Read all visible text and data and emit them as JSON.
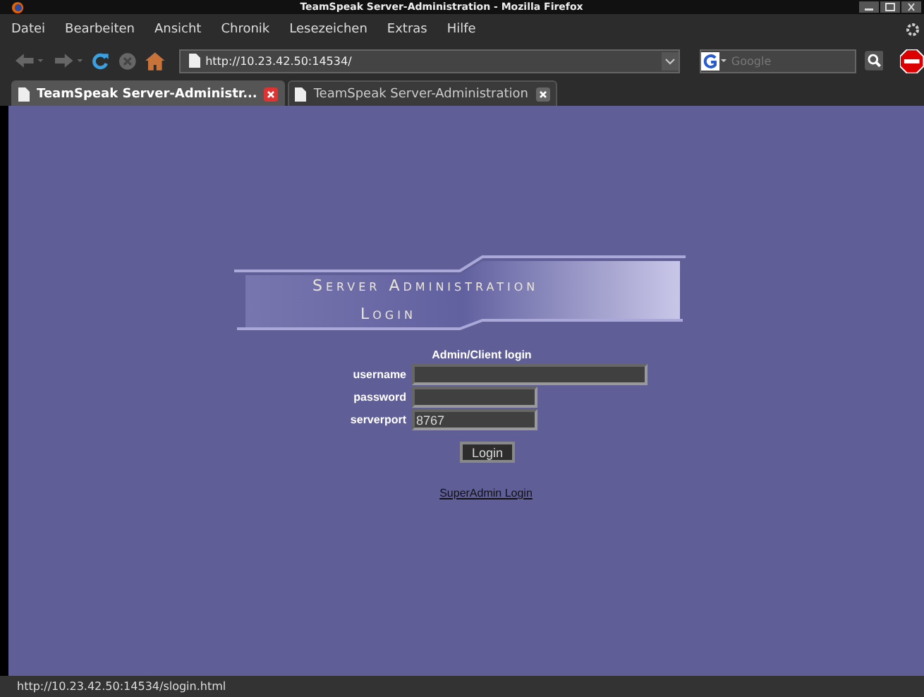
{
  "window": {
    "title": "TeamSpeak Server-Administration - Mozilla Firefox"
  },
  "menu": [
    "Datei",
    "Bearbeiten",
    "Ansicht",
    "Chronik",
    "Lesezeichen",
    "Extras",
    "Hilfe"
  ],
  "address": {
    "value": "http://10.23.42.50:14534/"
  },
  "search": {
    "placeholder": "Google"
  },
  "tabs": [
    {
      "label": "TeamSpeak Server-Administr...",
      "selected": true
    },
    {
      "label": "TeamSpeak Server-Administration",
      "selected": false
    }
  ],
  "page": {
    "banner": {
      "line_1": "Server Administration",
      "line_2": "Login"
    },
    "form_title": "Admin/Client login",
    "fields": [
      {
        "label": "username"
      },
      {
        "label": "password"
      },
      {
        "label": "serverport",
        "value": "8767"
      }
    ],
    "button": "Login",
    "link": "SuperAdmin Login"
  },
  "status_bar": "http://10.23.42.50:14534/slogin.html"
}
